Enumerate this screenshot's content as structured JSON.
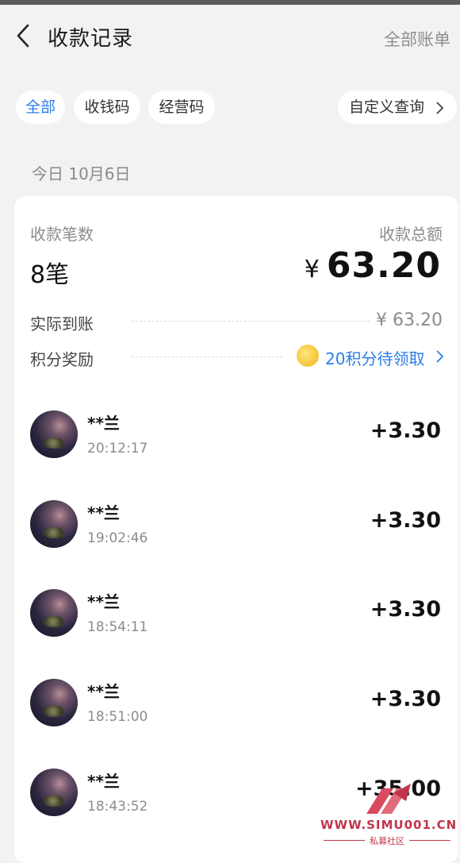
{
  "nav": {
    "title": "收款记录",
    "right_link": "全部账单"
  },
  "filters": [
    {
      "label": "全部",
      "active": true
    },
    {
      "label": "收钱码",
      "active": false
    },
    {
      "label": "经营码",
      "active": false
    }
  ],
  "custom_query": "自定义查询",
  "date_header": "今日 10月6日",
  "summary": {
    "count_label": "收款笔数",
    "count_value": "8笔",
    "total_label": "收款总额",
    "total_currency": "¥",
    "total_value": "63.20",
    "actual_label": "实际到账",
    "actual_value": "¥ 63.20",
    "reward_label": "积分奖励",
    "reward_value": "20积分待领取"
  },
  "transactions": [
    {
      "name": "**兰",
      "time": "20:12:17",
      "amount": "+3.30"
    },
    {
      "name": "**兰",
      "time": "19:02:46",
      "amount": "+3.30"
    },
    {
      "name": "**兰",
      "time": "18:54:11",
      "amount": "+3.30"
    },
    {
      "name": "**兰",
      "time": "18:51:00",
      "amount": "+3.30"
    },
    {
      "name": "**兰",
      "time": "18:43:52",
      "amount": "+35.00"
    }
  ],
  "watermark": {
    "text": "WWW.SIMU001.CN",
    "sub": "私募社区"
  },
  "colors": {
    "accent": "#2b7de9",
    "background": "#f2f2f2",
    "card": "#ffffff",
    "watermark": "#c0354b"
  }
}
